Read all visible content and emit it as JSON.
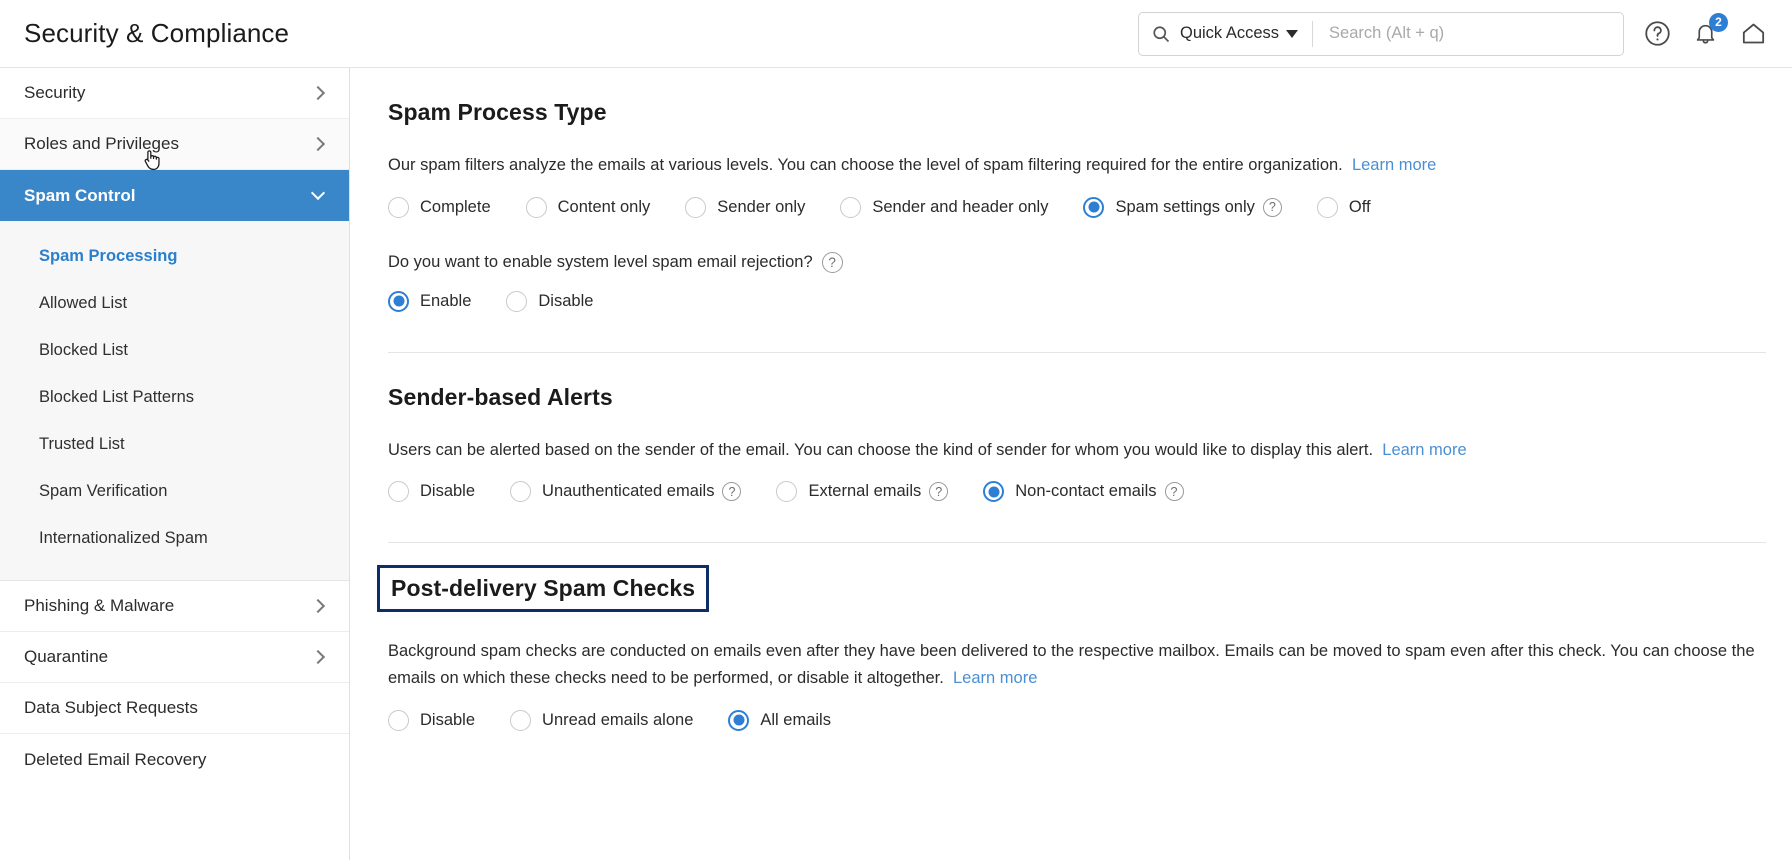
{
  "header": {
    "title": "Security & Compliance",
    "quick_access_label": "Quick Access",
    "search_placeholder": "Search (Alt + q)",
    "search_value": "",
    "search_icon": "search-icon",
    "caret_icon": "chevron-down-icon",
    "help_icon": "help-circle-icon",
    "notification_icon": "bell-icon",
    "notification_count": "2",
    "home_icon": "home-icon",
    "accent_color": "#2e7fd4"
  },
  "sidebar": {
    "items": [
      {
        "label": "Security",
        "expandable": true,
        "state": "collapsed"
      },
      {
        "label": "Roles and Privileges",
        "expandable": true,
        "state": "collapsed"
      },
      {
        "label": "Spam Control",
        "expandable": true,
        "state": "expanded"
      }
    ],
    "sub_items": [
      {
        "label": "Spam Processing",
        "selected": true
      },
      {
        "label": "Allowed List",
        "selected": false
      },
      {
        "label": "Blocked List",
        "selected": false
      },
      {
        "label": "Blocked List Patterns",
        "selected": false
      },
      {
        "label": "Trusted List",
        "selected": false
      },
      {
        "label": "Spam Verification",
        "selected": false
      },
      {
        "label": "Internationalized Spam",
        "selected": false
      }
    ],
    "items_after": [
      {
        "label": "Phishing & Malware",
        "expandable": true
      },
      {
        "label": "Quarantine",
        "expandable": true
      },
      {
        "label": "Data Subject Requests",
        "expandable": false
      },
      {
        "label": "Deleted Email Recovery",
        "expandable": false
      }
    ],
    "active_color": "#3986c8",
    "selected_link_color": "#2b7fcc"
  },
  "main": {
    "spam_process_type": {
      "title": "Spam Process Type",
      "description": "Our spam filters analyze the emails at various levels. You can choose the level of spam filtering required for the entire organization.",
      "learn_more": "Learn more",
      "options": [
        {
          "label": "Complete",
          "selected": false,
          "help": false
        },
        {
          "label": "Content only",
          "selected": false,
          "help": false
        },
        {
          "label": "Sender only",
          "selected": false,
          "help": false
        },
        {
          "label": "Sender and header only",
          "selected": false,
          "help": false
        },
        {
          "label": "Spam settings only",
          "selected": true,
          "help": true
        },
        {
          "label": "Off",
          "selected": false,
          "help": false
        }
      ],
      "sub_question": "Do you want to enable system level spam email rejection?",
      "sub_question_help": "?",
      "sub_options": [
        {
          "label": "Enable",
          "selected": true
        },
        {
          "label": "Disable",
          "selected": false
        }
      ]
    },
    "sender_based_alerts": {
      "title": "Sender-based Alerts",
      "description": "Users can be alerted based on the sender of the email. You can choose the kind of sender for whom you would like to display this alert.",
      "learn_more": "Learn more",
      "options": [
        {
          "label": "Disable",
          "selected": false,
          "help": false
        },
        {
          "label": "Unauthenticated emails",
          "selected": false,
          "help": true
        },
        {
          "label": "External emails",
          "selected": false,
          "help": true
        },
        {
          "label": "Non-contact emails",
          "selected": true,
          "help": true
        }
      ]
    },
    "post_delivery_spam_checks": {
      "title": "Post-delivery Spam Checks",
      "focused": true,
      "description": "Background spam checks are conducted on emails even after they have been delivered to the respective mailbox. Emails can be moved to spam even after this check. You can choose the emails on which these checks need to be performed, or disable it altogether.",
      "learn_more": "Learn more",
      "options": [
        {
          "label": "Disable",
          "selected": false,
          "help": false
        },
        {
          "label": "Unread emails alone",
          "selected": false,
          "help": false
        },
        {
          "label": "All emails",
          "selected": true,
          "help": false
        }
      ]
    }
  }
}
